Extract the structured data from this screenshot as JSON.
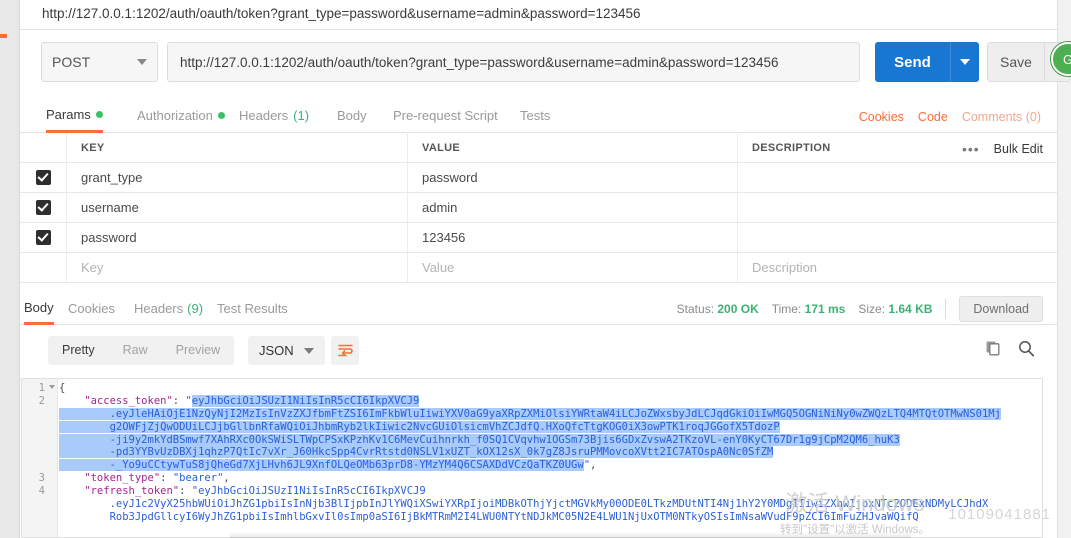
{
  "tab": {
    "title": "http://127.0.0.1:1202/auth/oauth/token?grant_type=password&username=admin&password=123456"
  },
  "request": {
    "method": "POST",
    "url": "http://127.0.0.1:1202/auth/oauth/token?grant_type=password&username=admin&password=123456",
    "send_label": "Send",
    "save_label": "Save",
    "avatar_badge": "G"
  },
  "request_tabs": [
    {
      "label": "Params",
      "badge": "dot",
      "active": true
    },
    {
      "label": "Authorization",
      "badge": "dot",
      "active": false
    },
    {
      "label": "Headers",
      "count": "(1)",
      "active": false
    },
    {
      "label": "Body",
      "active": false
    },
    {
      "label": "Pre-request Script",
      "active": false
    },
    {
      "label": "Tests",
      "active": false
    }
  ],
  "request_links": {
    "cookies": "Cookies",
    "code": "Code",
    "comments": "Comments (0)"
  },
  "params_table": {
    "headers": {
      "key": "KEY",
      "value": "VALUE",
      "description": "DESCRIPTION"
    },
    "bulk_edit": "Bulk Edit",
    "more": "•••",
    "rows": [
      {
        "checked": true,
        "key": "grant_type",
        "value": "password",
        "description": ""
      },
      {
        "checked": true,
        "key": "username",
        "value": "admin",
        "description": ""
      },
      {
        "checked": true,
        "key": "password",
        "value": "123456",
        "description": ""
      }
    ],
    "placeholder_row": {
      "key": "Key",
      "value": "Value",
      "description": "Description"
    }
  },
  "response_tabs": [
    {
      "label": "Body",
      "active": true
    },
    {
      "label": "Cookies",
      "active": false
    },
    {
      "label": "Headers",
      "count": "(9)",
      "active": false
    },
    {
      "label": "Test Results",
      "active": false
    }
  ],
  "response_stats": {
    "status_label": "Status:",
    "status_value": "200 OK",
    "time_label": "Time:",
    "time_value": "171 ms",
    "size_label": "Size:",
    "size_value": "1.64 KB",
    "download_label": "Download"
  },
  "format_bar": {
    "modes": [
      "Pretty",
      "Raw",
      "Preview"
    ],
    "active_mode": "Pretty",
    "language": "JSON"
  },
  "code": {
    "lines": [
      {
        "num": "1",
        "fold": true,
        "segments": [
          {
            "t": "{",
            "c": "k-brace"
          }
        ]
      },
      {
        "num": "2",
        "fold": false,
        "segments": [
          {
            "t": "    \"access_token\"",
            "c": "k-key"
          },
          {
            "t": ": ",
            "c": "k-punc"
          },
          {
            "t": "\"",
            "c": "k-str"
          },
          {
            "t": "eyJhbGciOiJSUzI1NiIsInR5cCI6IkpXVCJ9",
            "c": "k-str sel"
          }
        ]
      },
      {
        "num": "",
        "fold": false,
        "segments": [
          {
            "t": "        .eyJleHAiOjE1NzQyNjI2MzIsInVzZXJfbmFtZSI6ImFkbWluIiwiYXV0aG9yaXRpZXMiOlsiYWRtaW4iLCJoZWxsbyJdLCJqdGkiOiIwMGQ5OGNiNiNy0wZWQzLTQ4MTQtOTMwNS01Mj",
            "c": "k-str sel"
          }
        ]
      },
      {
        "num": "",
        "fold": false,
        "segments": [
          {
            "t": "        g2OWFjZjQwODUiLCJjbGllbnRfaWQiOiJhbmRyb2lkIiwic2NvcGUiOlsicmVhZCJdfQ.HXoQfcTtgKOG0iX3owPTK1roqJGGofX5TdozP",
            "c": "k-str sel"
          }
        ]
      },
      {
        "num": "",
        "fold": false,
        "segments": [
          {
            "t": "        -ji9y2mkYdBSmwf7XAhRXc0OkSWiSLTWpCPSxKPzhKv1C6MevCuihnrkh_f0SQ1CVqvhw1OGSm73Bjis6GDxZvswA2TKzoVL-enY0KyCT67Dr1g9jCpM2QM6_huK3",
            "c": "k-str sel"
          }
        ]
      },
      {
        "num": "",
        "fold": false,
        "segments": [
          {
            "t": "        -pd3YYBvUzDBXj1qhzP7QtIc7vXr_J60HkcSpp4CvrRtstd0NSLV1xUZT_kOX12sX_0k7gZ8JsruPMMovcoXVtt2IC7ATOspA0Nc0SfZM",
            "c": "k-str sel"
          }
        ]
      },
      {
        "num": "",
        "fold": false,
        "segments": [
          {
            "t": "        -_Yo9uCCtywTuS8jQheGd7XjLHvh6JL9XnfOLQeOMb63prD8-YMzYM4Q6CSAXDdVCzQaTKZ0UGw",
            "c": "k-str sel"
          },
          {
            "t": "\"",
            "c": "k-str"
          },
          {
            "t": ",",
            "c": "k-punc"
          }
        ]
      },
      {
        "num": "3",
        "fold": false,
        "segments": [
          {
            "t": "    \"token_type\"",
            "c": "k-key"
          },
          {
            "t": ": ",
            "c": "k-punc"
          },
          {
            "t": "\"bearer\"",
            "c": "k-str"
          },
          {
            "t": ",",
            "c": "k-punc"
          }
        ]
      },
      {
        "num": "4",
        "fold": false,
        "segments": [
          {
            "t": "    \"refresh_token\"",
            "c": "k-key"
          },
          {
            "t": ": ",
            "c": "k-punc"
          },
          {
            "t": "\"eyJhbGciOiJSUzI1NiIsInR5cCI6IkpXVCJ9",
            "c": "k-str"
          }
        ]
      },
      {
        "num": "",
        "fold": false,
        "segments": [
          {
            "t": "        .eyJ1c2VyX25hbWUiOiJhZG1pbiIsInNjb3BlIjpbInJlYWQiXSwiYXRpIjoiMDBkOThjYjctMGVkMy00ODE0LTkzMDUtNTI4Nj1hY2Y0MDg1IiwiZXhwIjoxNTc2ODExNDMyLCJhdX",
            "c": "k-str"
          }
        ]
      },
      {
        "num": "",
        "fold": false,
        "segments": [
          {
            "t": "        Rob3JpdGllcyI6WyJhZG1pbiIsImhlbGxvIl0sImp0aSI6IjBkMTRmM2I4LWU0NTYtNDJkMC05N2E4LWU1NjUxOTM0NTkyOSIsImNsaWVudF9pZCI6ImFuZHJvaWQifQ",
            "c": "k-str"
          }
        ]
      }
    ]
  },
  "watermark": {
    "line1": "激活 Windows",
    "line2": "转到\"设置\"以激活 Windows。",
    "id": "10109041881"
  }
}
